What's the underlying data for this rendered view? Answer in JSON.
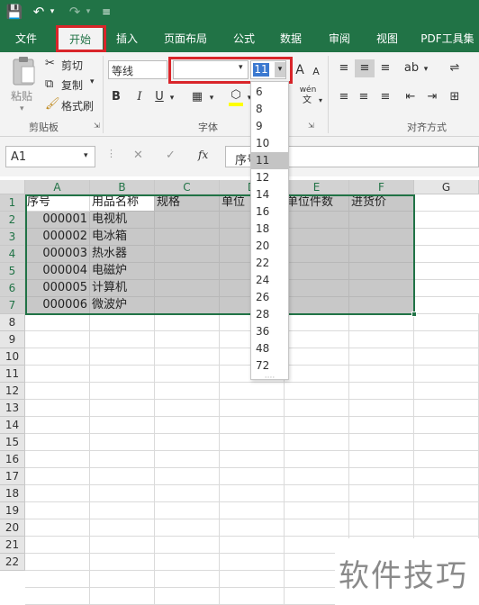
{
  "quick_access": {
    "save_icon": "💾",
    "undo_icon": "↶",
    "undo_arrow": "▾",
    "redo_icon": "↷",
    "redo_arrow": "▾",
    "customize_icon": "≡"
  },
  "tabs": [
    {
      "label": "文件"
    },
    {
      "label": "开始"
    },
    {
      "label": "插入"
    },
    {
      "label": "页面布局"
    },
    {
      "label": "公式"
    },
    {
      "label": "数据"
    },
    {
      "label": "审阅"
    },
    {
      "label": "视图"
    },
    {
      "label": "PDF工具集"
    }
  ],
  "clipboard": {
    "paste_label": "粘贴",
    "cut_label": "剪切",
    "copy_label": "复制",
    "format_painter_label": "格式刷",
    "group_label": "剪贴板"
  },
  "font": {
    "font_name": "等线",
    "font_size_value": "11",
    "group_label": "字体",
    "bold": "B",
    "italic": "I",
    "underline": "U",
    "grow_label": "A",
    "shrink_label": "A",
    "phonetic_label": "wén",
    "phonetic_sub": "文"
  },
  "alignment": {
    "group_label": "对齐方式"
  },
  "name_box": {
    "value": "A1"
  },
  "formula_bar": {
    "cancel_icon": "✕",
    "enter_icon": "✓",
    "fx_label": "fx",
    "content_partial": "序号"
  },
  "font_size_list": {
    "options": [
      "6",
      "8",
      "9",
      "10",
      "11",
      "12",
      "14",
      "16",
      "18",
      "20",
      "22",
      "24",
      "26",
      "28",
      "36",
      "48",
      "72"
    ],
    "current": "11",
    "resize_grip": "····"
  },
  "columns": [
    "A",
    "B",
    "C",
    "D",
    "E",
    "F",
    "G"
  ],
  "rows": [
    "1",
    "2",
    "3",
    "4",
    "5",
    "6",
    "7",
    "8",
    "9",
    "10",
    "11",
    "12",
    "13",
    "14",
    "15",
    "16",
    "17",
    "18",
    "19",
    "20",
    "21",
    "22"
  ],
  "sheet": {
    "headers": [
      "序号",
      "用品名称",
      "规格",
      "单位",
      "单位件数",
      "进货价"
    ],
    "data": [
      [
        "000001",
        "电视机"
      ],
      [
        "000002",
        "电冰箱"
      ],
      [
        "000003",
        "热水器"
      ],
      [
        "000004",
        "电磁炉"
      ],
      [
        "000005",
        "计算机"
      ],
      [
        "000006",
        "微波炉"
      ]
    ]
  },
  "watermark": "软件技巧",
  "colors": {
    "accent": "#217346",
    "highlight_box": "#d9252a"
  }
}
